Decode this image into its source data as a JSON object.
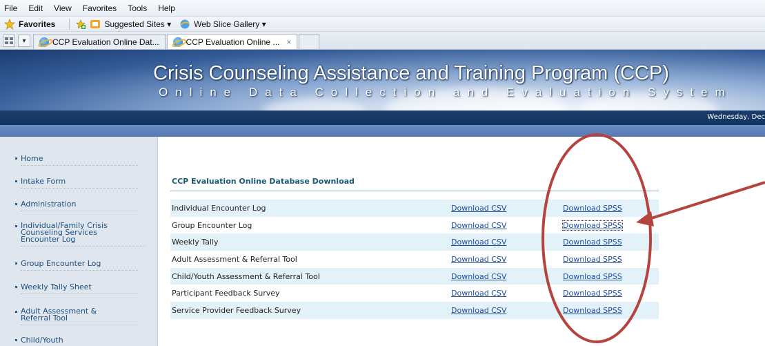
{
  "browser": {
    "menu": [
      "File",
      "Edit",
      "View",
      "Favorites",
      "Tools",
      "Help"
    ],
    "favorites_label": "Favorites",
    "suggested_sites": "Suggested Sites ▾",
    "web_slice_gallery": "Web Slice Gallery ▾",
    "tabs": [
      {
        "label": "CCP Evaluation Online Dat...",
        "active": false
      },
      {
        "label": "CCP Evaluation Online ...",
        "active": true
      }
    ],
    "close_glyph": "×"
  },
  "banner": {
    "title": "Crisis Counseling Assistance and Training Program (CCP)",
    "subtitle": "Online Data Collection and Evaluation System"
  },
  "date_text": "Wednesday, Dec",
  "sidebar": {
    "items": [
      "Home",
      "Intake Form",
      "Administration",
      "Individual/Family Crisis Counseling Services Encounter Log",
      "Group Encounter Log",
      "Weekly Tally Sheet",
      "Adult Assessment & Referral Tool",
      "Child/Youth"
    ]
  },
  "main": {
    "heading": "CCP Evaluation Online Database Download",
    "rows": [
      {
        "name": "Individual Encounter Log",
        "csv": "Download CSV",
        "spss": "Download SPSS"
      },
      {
        "name": "Group Encounter Log",
        "csv": "Download CSV",
        "spss": "Download SPSS"
      },
      {
        "name": "Weekly Tally",
        "csv": "Download CSV",
        "spss": "Download SPSS"
      },
      {
        "name": "Adult Assessment & Referral Tool",
        "csv": "Download CSV",
        "spss": "Download SPSS"
      },
      {
        "name": "Child/Youth Assessment & Referral Tool",
        "csv": "Download CSV",
        "spss": "Download SPSS"
      },
      {
        "name": "Participant Feedback Survey",
        "csv": "Download CSV",
        "spss": "Download SPSS"
      },
      {
        "name": "Service Provider Feedback Survey",
        "csv": "Download CSV",
        "spss": "Download SPSS"
      }
    ]
  },
  "colors": {
    "link": "#1f4ea3",
    "annotation": "#b5443f",
    "banner_dark": "#17365f",
    "row_alt": "#e3f1f9"
  }
}
